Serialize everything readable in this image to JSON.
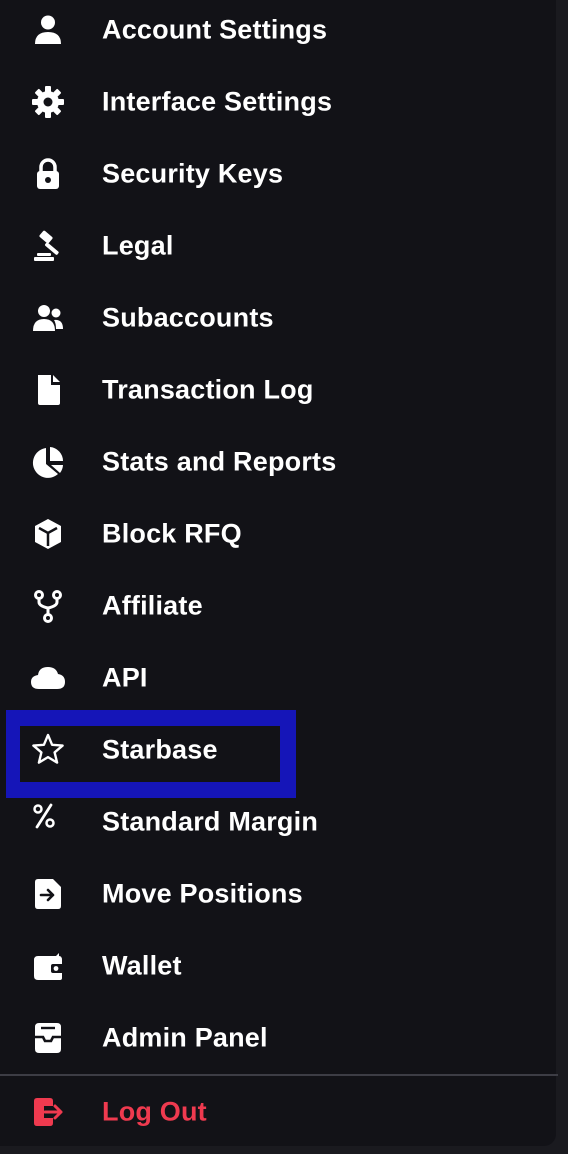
{
  "menu": {
    "items": [
      {
        "label": "Account Settings",
        "icon": "user-icon"
      },
      {
        "label": "Interface Settings",
        "icon": "gear-icon"
      },
      {
        "label": "Security Keys",
        "icon": "lock-icon"
      },
      {
        "label": "Legal",
        "icon": "gavel-icon"
      },
      {
        "label": "Subaccounts",
        "icon": "users-icon"
      },
      {
        "label": "Transaction Log",
        "icon": "file-icon"
      },
      {
        "label": "Stats and Reports",
        "icon": "pie-chart-icon"
      },
      {
        "label": "Block RFQ",
        "icon": "cube-icon"
      },
      {
        "label": "Affiliate",
        "icon": "fork-icon"
      },
      {
        "label": "API",
        "icon": "cloud-icon"
      },
      {
        "label": "Starbase",
        "icon": "star-icon",
        "highlighted": true
      },
      {
        "label": "Standard Margin",
        "icon": "percent-icon"
      },
      {
        "label": "Move Positions",
        "icon": "move-file-icon"
      },
      {
        "label": "Wallet",
        "icon": "wallet-icon"
      },
      {
        "label": "Admin Panel",
        "icon": "inbox-icon"
      }
    ],
    "logout": {
      "label": "Log Out",
      "icon": "logout-icon"
    }
  },
  "colors": {
    "panel_background": "#121217",
    "text": "#ffffff",
    "danger": "#ef3a4f",
    "highlight_border": "#1515b8",
    "divider": "#3d3d45"
  }
}
